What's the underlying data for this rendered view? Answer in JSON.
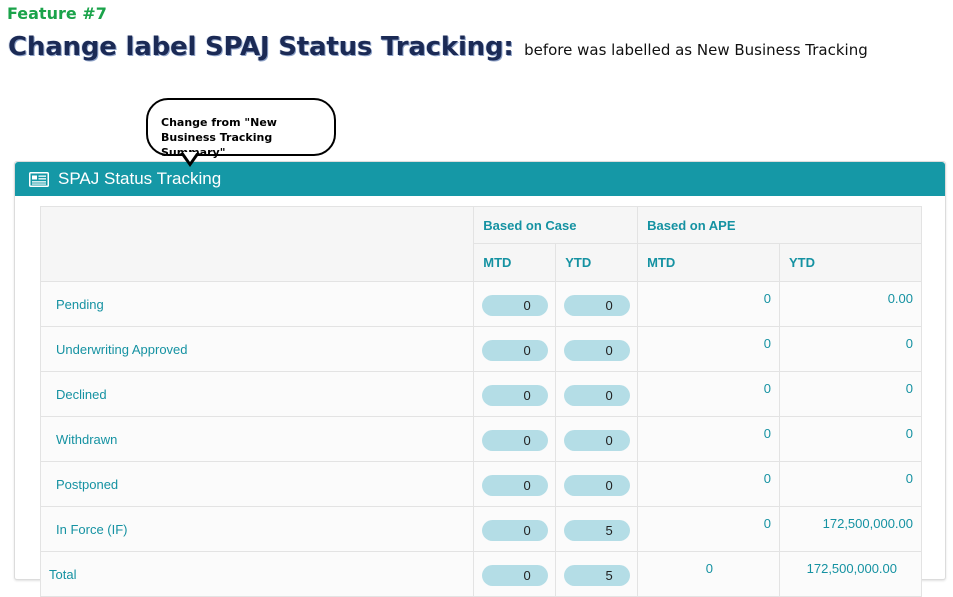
{
  "feature": {
    "label": "Feature #7"
  },
  "heading": {
    "title": "Change label SPAJ Status Tracking:",
    "subtitle": "before was labelled as New Business Tracking"
  },
  "callout": {
    "text": "Change from \"New Business Tracking Summary\""
  },
  "panel": {
    "title": "SPAJ Status Tracking",
    "icon": "newspaper-icon",
    "accent_color": "#1598a6"
  },
  "table": {
    "groups": {
      "case": "Based on Case",
      "ape": "Based on APE"
    },
    "columns": {
      "case_mtd": "MTD",
      "case_ytd": "YTD",
      "ape_mtd": "MTD",
      "ape_ytd": "YTD"
    },
    "rows": [
      {
        "label": "Pending",
        "case_mtd": "0",
        "case_ytd": "0",
        "ape_mtd": "0",
        "ape_ytd": "0.00"
      },
      {
        "label": "Underwriting Approved",
        "case_mtd": "0",
        "case_ytd": "0",
        "ape_mtd": "0",
        "ape_ytd": "0"
      },
      {
        "label": "Declined",
        "case_mtd": "0",
        "case_ytd": "0",
        "ape_mtd": "0",
        "ape_ytd": "0"
      },
      {
        "label": "Withdrawn",
        "case_mtd": "0",
        "case_ytd": "0",
        "ape_mtd": "0",
        "ape_ytd": "0"
      },
      {
        "label": "Postponed",
        "case_mtd": "0",
        "case_ytd": "0",
        "ape_mtd": "0",
        "ape_ytd": "0"
      },
      {
        "label": "In Force (IF)",
        "case_mtd": "0",
        "case_ytd": "5",
        "ape_mtd": "0",
        "ape_ytd": "172,500,000.00"
      }
    ],
    "total": {
      "label": "Total",
      "case_mtd": "0",
      "case_ytd": "5",
      "ape_mtd": "0",
      "ape_ytd": "172,500,000.00"
    }
  }
}
